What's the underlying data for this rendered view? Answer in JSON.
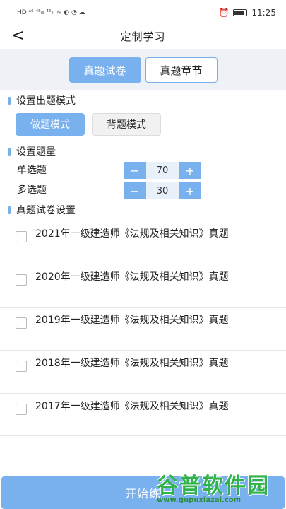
{
  "status_bar": {
    "left_indicators": "HD ᵃ⁶ ⁴⁶ᵢₗₗ ⁴⁶ᵢₗₗ ≋ ◐ ◔ ☁",
    "time": "11:25"
  },
  "navbar": {
    "back": "<",
    "title": "定制学习"
  },
  "tabs": [
    {
      "label": "真题试卷",
      "active": true
    },
    {
      "label": "真题章节",
      "active": false
    }
  ],
  "mode_section": {
    "title": "设置出题模式",
    "options": [
      {
        "label": "做题模式",
        "active": true
      },
      {
        "label": "背题模式",
        "active": false
      }
    ]
  },
  "quantity_section": {
    "title": "设置题量",
    "rows": [
      {
        "label": "单选题",
        "value": "70",
        "minus": "−",
        "plus": "+"
      },
      {
        "label": "多选题",
        "value": "30",
        "minus": "−",
        "plus": "+"
      }
    ]
  },
  "papers_section": {
    "title": "真题试卷设置",
    "items": [
      "2021年一级建造师《法规及相关知识》真题",
      "2020年一级建造师《法规及相关知识》真题",
      "2019年一级建造师《法规及相关知识》真题",
      "2018年一级建造师《法规及相关知识》真题",
      "2017年一级建造师《法规及相关知识》真题"
    ]
  },
  "start_button": "开始练",
  "watermark": {
    "logo": "谷普软件园",
    "url": "www.gupuxiazai.com"
  }
}
